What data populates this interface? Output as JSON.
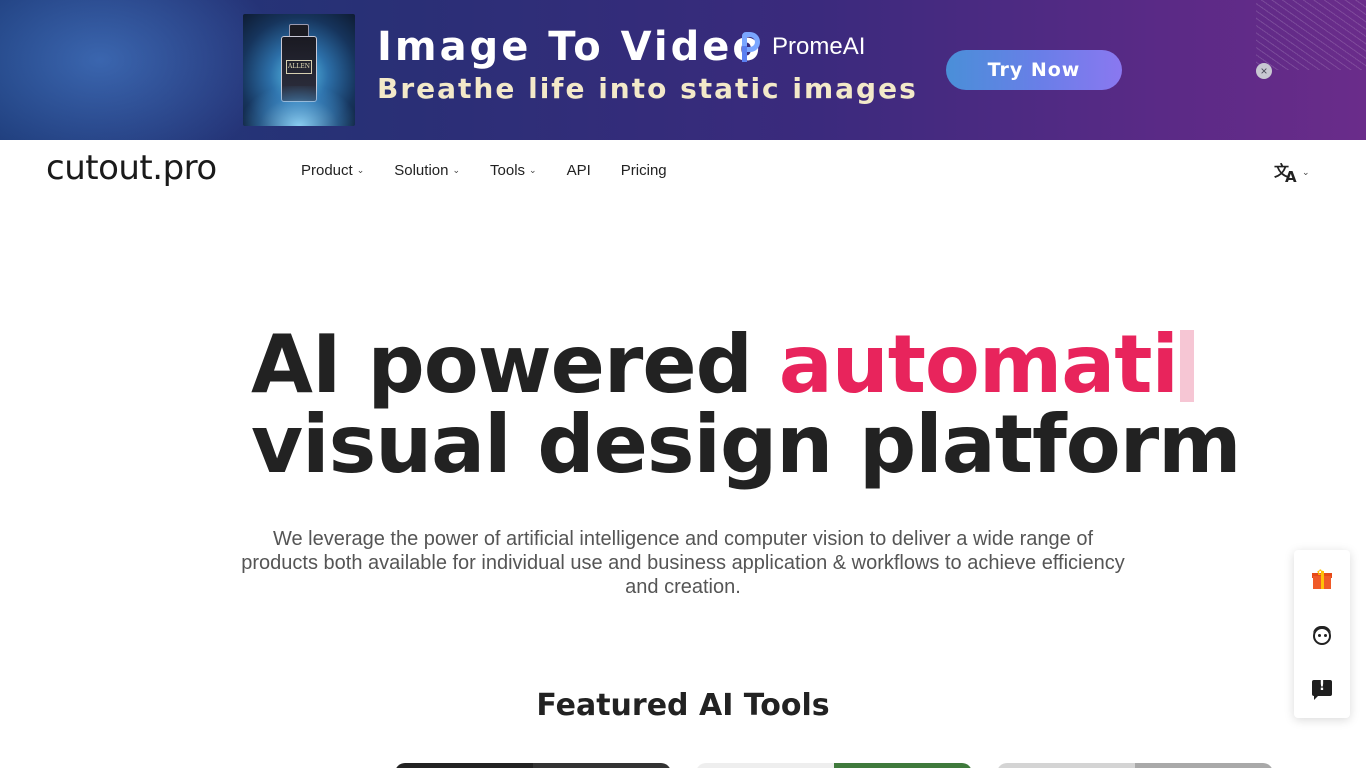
{
  "banner": {
    "title": "Image To Video",
    "brand": "PromeAI",
    "subtitle": "Breathe life into static images",
    "cta": "Try Now",
    "close": "×",
    "product_label": "ALLEN"
  },
  "nav": {
    "logo": "cutout.pro",
    "items": [
      {
        "label": "Product",
        "has_dropdown": true
      },
      {
        "label": "Solution",
        "has_dropdown": true
      },
      {
        "label": "Tools",
        "has_dropdown": true
      },
      {
        "label": "API",
        "has_dropdown": false
      },
      {
        "label": "Pricing",
        "has_dropdown": false
      }
    ],
    "language_icon": "translate-icon"
  },
  "hero": {
    "line1_prefix": "AI powered ",
    "line1_accent": "automati",
    "line2": "visual design platform",
    "description": "We leverage the power of artificial intelligence and computer vision to deliver a wide range of products both available for individual use and business application & workflows to achieve efficiency and creation."
  },
  "featured": {
    "heading": "Featured AI Tools"
  },
  "side_widget": {
    "items": [
      "gift-icon",
      "support-icon",
      "feedback-icon"
    ]
  },
  "colors": {
    "accent": "#e8245c",
    "text": "#222222",
    "muted": "#555555",
    "banner_cta": "#6a7ee8"
  }
}
